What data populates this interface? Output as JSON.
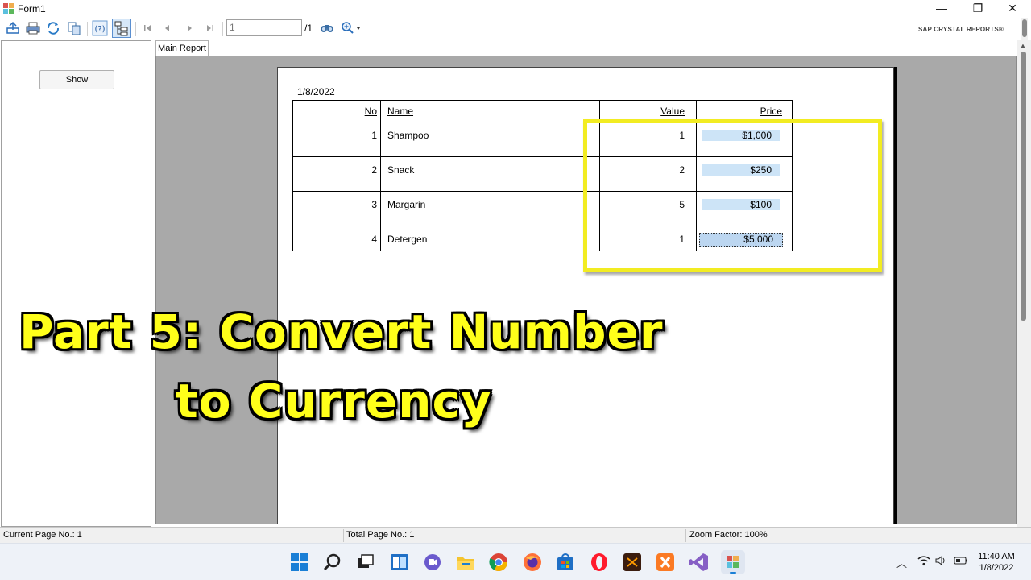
{
  "window": {
    "title": "Form1",
    "minimize": "—",
    "restore": "❐",
    "close": "✕"
  },
  "toolbar": {
    "page_current": "1",
    "page_total": "/1",
    "brand": "SAP CRYSTAL REPORTS®"
  },
  "left_panel": {
    "show_label": "Show"
  },
  "tabs": [
    {
      "label": "Main Report"
    }
  ],
  "report": {
    "date": "1/8/2022",
    "headers": {
      "no": "No",
      "name": "Name",
      "value": "Value",
      "price": "Price"
    },
    "rows": [
      {
        "no": "1",
        "name": "Shampoo",
        "value": "1",
        "price": "$1,000"
      },
      {
        "no": "2",
        "name": "Snack",
        "value": "2",
        "price": "$250"
      },
      {
        "no": "3",
        "name": "Margarin",
        "value": "5",
        "price": "$100"
      },
      {
        "no": "4",
        "name": "Detergen",
        "value": "1",
        "price": "$5,000"
      }
    ]
  },
  "overlay": {
    "line1": "Part 5: Convert Number",
    "line2": "to Currency",
    "color": "#ffff1a"
  },
  "statusbar": {
    "current_page": "Current Page No.: 1",
    "total_page": "Total Page No.: 1",
    "zoom": "Zoom Factor: 100%"
  },
  "taskbar": {
    "apps": [
      "windows-start-icon",
      "search-icon",
      "task-view-icon",
      "snap-layouts-icon",
      "chat-icon",
      "file-explorer-icon",
      "chrome-icon",
      "firefox-icon",
      "store-icon",
      "opera-icon",
      "photoshop-icon",
      "xampp-icon",
      "visual-studio-icon",
      "form-app-icon"
    ],
    "time": "11:40 AM",
    "date": "1/8/2022"
  },
  "colors": {
    "highlight": "#f2ec22",
    "price_fill": "#cde4f7",
    "report_bg": "#a9a9a9"
  }
}
